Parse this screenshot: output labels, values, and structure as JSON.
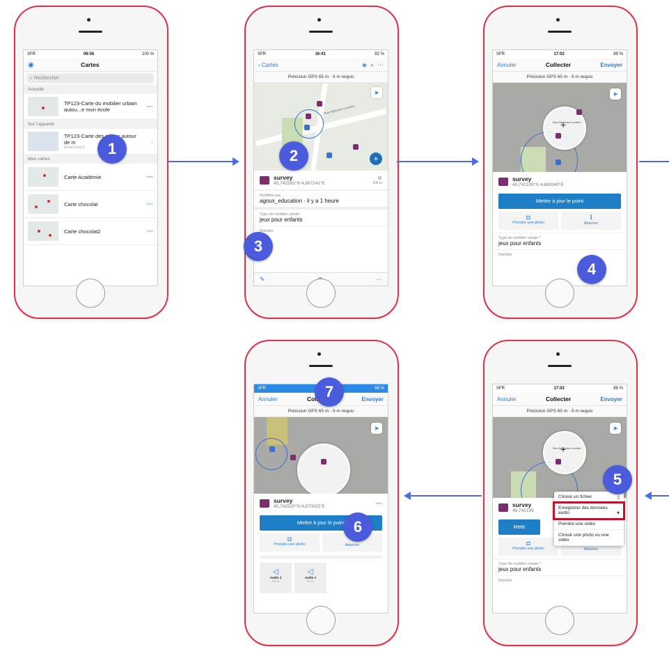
{
  "steps": [
    "1",
    "2",
    "3",
    "4",
    "5",
    "6",
    "7"
  ],
  "phone1": {
    "status": {
      "carrier": "SFR",
      "time": "09:56",
      "battery": "100 %"
    },
    "title": "Cartes",
    "search_placeholder": "Rechercher",
    "sections": [
      "Actuelle",
      "Sur l'appareil",
      "Mes cartes"
    ],
    "current": {
      "label": "TP123-Carte du mobilier urbain autou...e mon école"
    },
    "device": {
      "label": "TP123-Carte des arbres autour de m",
      "sub": "Zones hors d"
    },
    "maps": [
      "Carte Académie",
      "Carte chocolat",
      "Carte chocolat2"
    ]
  },
  "phone2": {
    "status": {
      "carrier": "SFR",
      "time": "16:41",
      "battery": "92 %"
    },
    "back": "Cartes",
    "gps": "Précision GPS 65 m · 9 m requis",
    "street": "Rue Alphonse Lumière",
    "feature": {
      "title": "survey",
      "coords": "45,742592°N  4,867241°E",
      "dist": "108 m"
    },
    "modified_label": "Modifiée par",
    "modified_value": "agoux_education · il y a 1 heure",
    "field_label": "Type de mobilier urbain",
    "field_value": "jeux pour enfants",
    "field2_label": "Nombre"
  },
  "phone3": {
    "status": {
      "carrier": "SFR",
      "time": "17:02",
      "battery": "89 %"
    },
    "cancel": "Annuler",
    "title": "Collecter",
    "send": "Envoyer",
    "gps": "Précision GPS 65 m · 9 m requis",
    "street": "Rue Alphonse Lumière",
    "feature": {
      "title": "survey",
      "coords": "45,742199°N  4,869340°E"
    },
    "update": "Mettre à jour le point",
    "photo": "Prendre une photo",
    "attach": "Attacher",
    "field_label": "Type de mobilier urbain *",
    "field_value": "jeux pour enfants",
    "field2_label": "Nombre"
  },
  "phone4": {
    "status": {
      "carrier": "SFR",
      "battery": "98 %"
    },
    "cancel": "Annuler",
    "title": "Collecter",
    "send": "Envoyer",
    "gps": "Précision GPS 65 m · 9 m requis",
    "feature": {
      "title": "survey",
      "coords": "45,742520°N  4,870025°E"
    },
    "update": "Mettre à jour le point",
    "photo": "Prendre une photo",
    "attach": "Attacher",
    "audio": [
      {
        "label": "Audio 2",
        "dur": "00:01"
      },
      {
        "label": "Audio 1",
        "dur": "00:01"
      }
    ]
  },
  "phone5": {
    "status": {
      "carrier": "SFR",
      "time": "17:02",
      "battery": "89 %"
    },
    "cancel": "Annuler",
    "title": "Collecter",
    "send": "Envoyer",
    "gps": "Précision GPS 65 m · 9 m requis",
    "street": "Rue Alphonse Lumière",
    "feature": {
      "title": "survey",
      "coords": "45,742199"
    },
    "update": "Mettr",
    "photo": "Prendre une photo",
    "attach": "Attacher",
    "menu": [
      "Choisir un fichier",
      "Enregistrer des données audio",
      "Prendre une vidéo",
      "Choisir une photo ou une vidéo"
    ],
    "field_label": "Type de mobilier urbain *",
    "field_value": "jeux pour enfants",
    "field2_label": "Nombre"
  },
  "colors": {
    "phone_frame": "#d9334a",
    "badge": "#4a5bdc",
    "arrow": "#4a6ee0",
    "primary": "#1e7fc7",
    "highlight": "#c0132a"
  }
}
